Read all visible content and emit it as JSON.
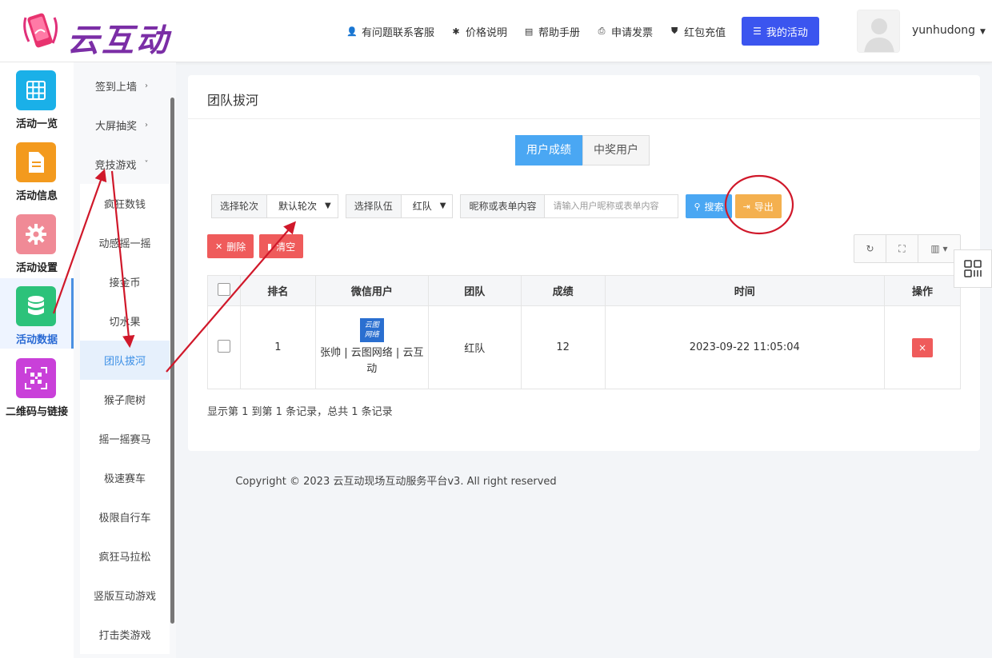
{
  "brand": {
    "logo_text": "云互动"
  },
  "topnav": {
    "items": [
      {
        "label": "有问题联系客服",
        "icon": "user-add-icon"
      },
      {
        "label": "价格说明",
        "icon": "gear-badge-icon"
      },
      {
        "label": "帮助手册",
        "icon": "book-icon"
      },
      {
        "label": "申请发票",
        "icon": "printer-icon"
      },
      {
        "label": "红包充值",
        "icon": "shield-check-icon"
      }
    ],
    "my_activity": "我的活动",
    "username": "yunhudong"
  },
  "iconbar": [
    {
      "label": "活动一览",
      "color": "#1ab0e8",
      "icon": "grid-icon"
    },
    {
      "label": "活动信息",
      "color": "#f39a1e",
      "icon": "document-icon"
    },
    {
      "label": "活动设置",
      "color": "#f08a96",
      "icon": "gear-icon"
    },
    {
      "label": "活动数据",
      "color": "#2cc27a",
      "icon": "database-icon",
      "active": true
    },
    {
      "label": "二维码与链接",
      "color": "#c940d9",
      "icon": "qrcode-icon"
    }
  ],
  "submenu": {
    "items": [
      {
        "label": "签到上墙",
        "type": "parent",
        "chevron": "›"
      },
      {
        "label": "大屏抽奖",
        "type": "parent",
        "chevron": "›"
      },
      {
        "label": "竞技游戏",
        "type": "parent",
        "chevron": "˅"
      },
      {
        "label": "疯狂数钱",
        "type": "child"
      },
      {
        "label": "动感摇一摇",
        "type": "child"
      },
      {
        "label": "接金币",
        "type": "child"
      },
      {
        "label": "切水果",
        "type": "child"
      },
      {
        "label": "团队拔河",
        "type": "child",
        "selected": true
      },
      {
        "label": "猴子爬树",
        "type": "child"
      },
      {
        "label": "摇一摇赛马",
        "type": "child"
      },
      {
        "label": "极速赛车",
        "type": "child"
      },
      {
        "label": "极限自行车",
        "type": "child"
      },
      {
        "label": "疯狂马拉松",
        "type": "child"
      },
      {
        "label": "竖版互动游戏",
        "type": "child"
      },
      {
        "label": "打击类游戏",
        "type": "child"
      }
    ]
  },
  "main": {
    "title": "团队拔河",
    "tabs": {
      "user_scores": "用户成绩",
      "winners": "中奖用户"
    },
    "filters": {
      "round_label": "选择轮次",
      "round_value": "默认轮次",
      "team_label": "选择队伍",
      "team_value": "红队",
      "query_label": "昵称或表单内容",
      "query_placeholder": "请输入用户昵称或表单内容"
    },
    "buttons": {
      "search": "搜索",
      "export": "导出",
      "delete": "删除",
      "clear": "清空"
    },
    "table": {
      "headers": [
        "排名",
        "微信用户",
        "团队",
        "成绩",
        "时间",
        "操作"
      ],
      "rows": [
        {
          "rank": "1",
          "logo_line1": "云图",
          "logo_line2": "网络",
          "user": "张帅 | 云图网络 | 云互动",
          "team": "红队",
          "score": "12",
          "time": "2023-09-22 11:05:04",
          "action": "×"
        }
      ]
    },
    "record_summary": "显示第 1 到第 1 条记录，总共 1 条记录"
  },
  "footer": {
    "copyright": "Copyright © 2023 云互动现场互动服务平台v3. All right reserved"
  },
  "colors": {
    "accent": "#4aa7f3",
    "primary": "#3b55ef",
    "danger": "#ef5b5b",
    "warning": "#f4b04f",
    "annotation": "#d0182a"
  }
}
